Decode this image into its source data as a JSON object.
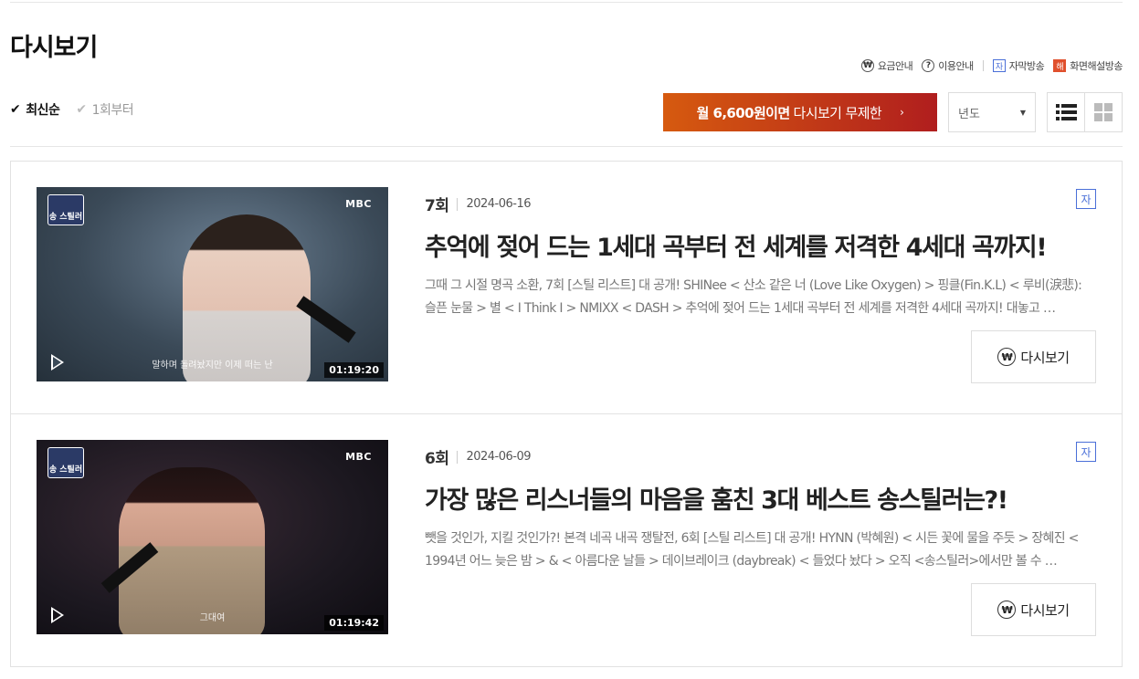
{
  "page": {
    "title": "다시보기"
  },
  "help_links": [
    {
      "icon": "won-circle-icon",
      "icon_glyph": "₩",
      "label": "요금안내"
    },
    {
      "icon": "question-circle-icon",
      "icon_glyph": "?",
      "label": "이용안내"
    },
    {
      "icon": "subtitle-badge-icon",
      "icon_glyph": "자",
      "label": "자막방송"
    },
    {
      "icon": "description-badge-icon",
      "icon_glyph": "해",
      "label": "화면해설방송"
    }
  ],
  "sort": {
    "options": [
      {
        "label": "최신순",
        "active": true
      },
      {
        "label": "1회부터",
        "active": false
      }
    ]
  },
  "promo": {
    "bold_text": "월 6,600원이면",
    "text": "다시보기 무제한",
    "arrow": "›"
  },
  "year_select": {
    "selected": "년도"
  },
  "view_modes": [
    "list",
    "grid"
  ],
  "episodes": [
    {
      "number": "7회",
      "date": "2024-06-16",
      "subtitle_badge": "자",
      "title": "추억에 젖어 드는 1세대 곡부터 전 세계를 저격한 4세대 곡까지!",
      "description": "그때 그 시절 명곡 소환, 7회 [스틸 리스트] 대 공개! SHINee < 산소 같은 너 (Love Like Oxygen) > 핑클(Fin.K.L) < 루비(淚悲):슬픈 눈물 > 별 < I Think I > NMIXX < DASH > 추억에 젖어 드는 1세대 곡부터 전 세계를 저격한 4세대 곡까지! 대놓고 …",
      "thumb_logo": "송 스틸러",
      "thumb_channel": "MBC",
      "thumb_caption": "말하며 돌려놨지만 이제 떠는 난",
      "duration": "01:19:20",
      "watch_label": "다시보기"
    },
    {
      "number": "6회",
      "date": "2024-06-09",
      "subtitle_badge": "자",
      "title": "가장 많은 리스너들의 마음을 훔친 3대 베스트 송스틸러는?!",
      "description": "뺏을 것인가, 지킬 것인가?! 본격 네곡 내곡 쟁탈전, 6회 [스틸 리스트] 대 공개! HYNN (박혜원) < 시든 꽃에 물을 주듯 > 장혜진 < 1994년 어느 늦은 밤 > & < 아름다운 날들 > 데이브레이크 (daybreak) < 들었다 놨다 > 오직 <송스틸러>에서만 볼 수 …",
      "thumb_logo": "송 스틸러",
      "thumb_channel": "MBC",
      "thumb_caption": "그대여",
      "duration": "01:19:42",
      "watch_label": "다시보기"
    }
  ],
  "colors": {
    "promo_start": "#d65a0f",
    "promo_end": "#b01e1e",
    "subtitle_badge": "#4a6fd8",
    "description_badge": "#e0502d"
  }
}
